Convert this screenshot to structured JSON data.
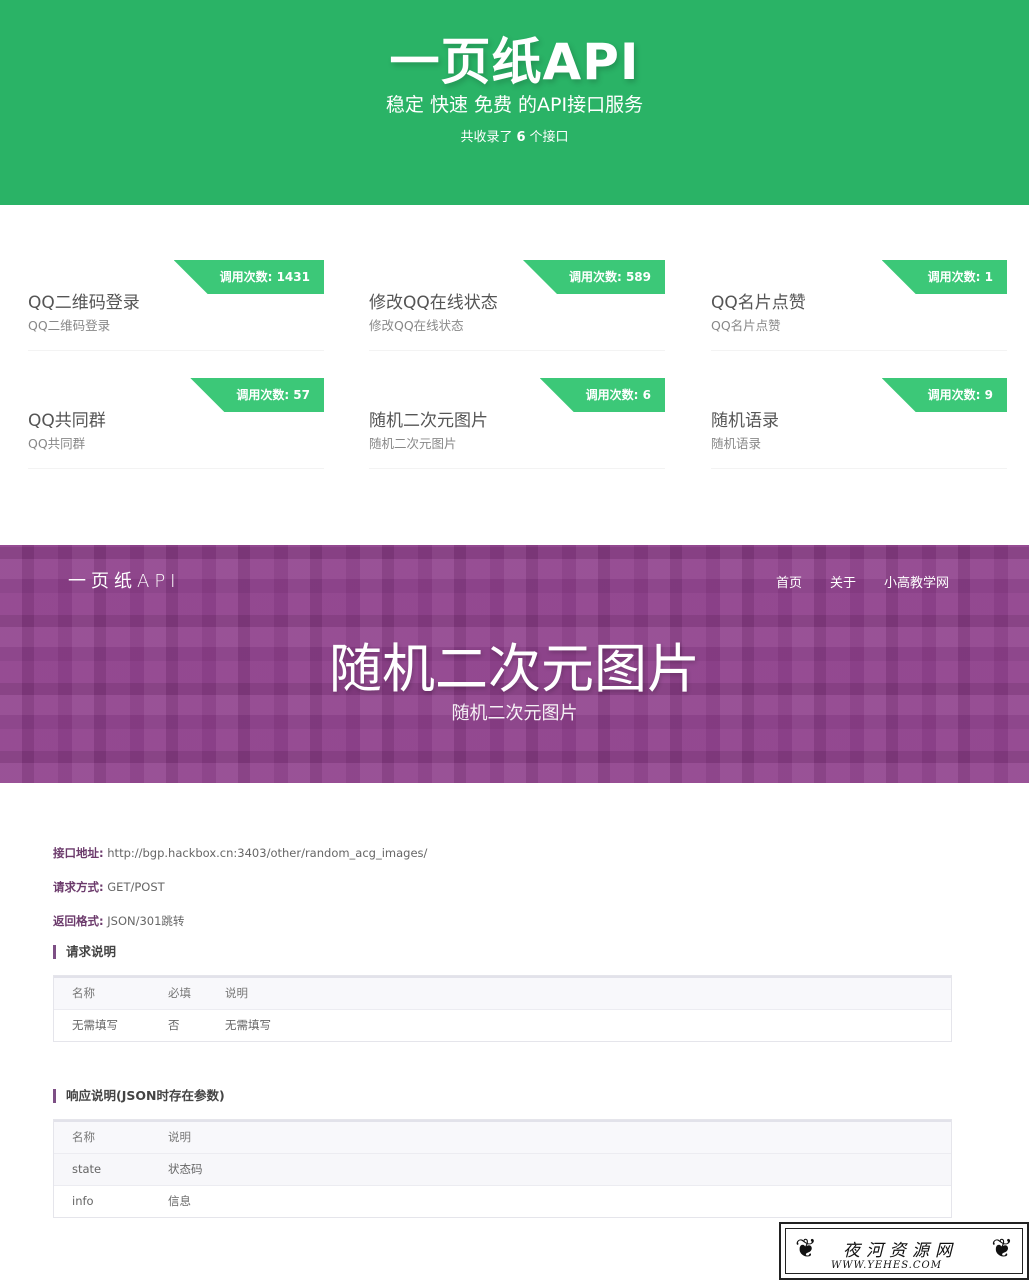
{
  "hero": {
    "title": "一页纸API",
    "subtitle": "稳定 快速 免费 的API接口服务",
    "count_prefix": "共收录了",
    "count_value": "6",
    "count_suffix": "个接口"
  },
  "cards": [
    {
      "badge": "调用次数: 1431",
      "title": "QQ二维码登录",
      "desc": "QQ二维码登录"
    },
    {
      "badge": "调用次数: 589",
      "title": "修改QQ在线状态",
      "desc": "修改QQ在线状态"
    },
    {
      "badge": "调用次数: 1",
      "title": "QQ名片点赞",
      "desc": "QQ名片点赞"
    },
    {
      "badge": "调用次数: 57",
      "title": "QQ共同群",
      "desc": "QQ共同群"
    },
    {
      "badge": "调用次数: 6",
      "title": "随机二次元图片",
      "desc": "随机二次元图片"
    },
    {
      "badge": "调用次数: 9",
      "title": "随机语录",
      "desc": "随机语录"
    }
  ],
  "banner": {
    "brand": "一页纸API",
    "nav": [
      "首页",
      "关于",
      "小高教学网"
    ],
    "title": "随机二次元图片",
    "subtitle": "随机二次元图片"
  },
  "details": {
    "endpoint_label": "接口地址:",
    "endpoint_value": "http://bgp.hackbox.cn:3403/other/random_acg_images/",
    "method_label": "请求方式:",
    "method_value": "GET/POST",
    "format_label": "返回格式:",
    "format_value": "JSON/301跳转",
    "request_heading": "请求说明",
    "request_table": {
      "headers": [
        "名称",
        "必填",
        "说明"
      ],
      "rows": [
        [
          "无需填写",
          "否",
          "无需填写"
        ]
      ]
    },
    "response_heading": "响应说明(JSON时存在参数)",
    "response_table": {
      "headers": [
        "名称",
        "说明"
      ],
      "rows": [
        [
          "state",
          "状态码"
        ],
        [
          "info",
          "信息"
        ]
      ]
    }
  },
  "watermark": {
    "name": "夜河资源网",
    "url": "WWW.YEHES.COM"
  },
  "colors": {
    "hero_green": "#2ab366",
    "badge_green": "#3cc878",
    "banner_purple": "#8e3f8b",
    "accent_purple": "#7d4f85"
  }
}
